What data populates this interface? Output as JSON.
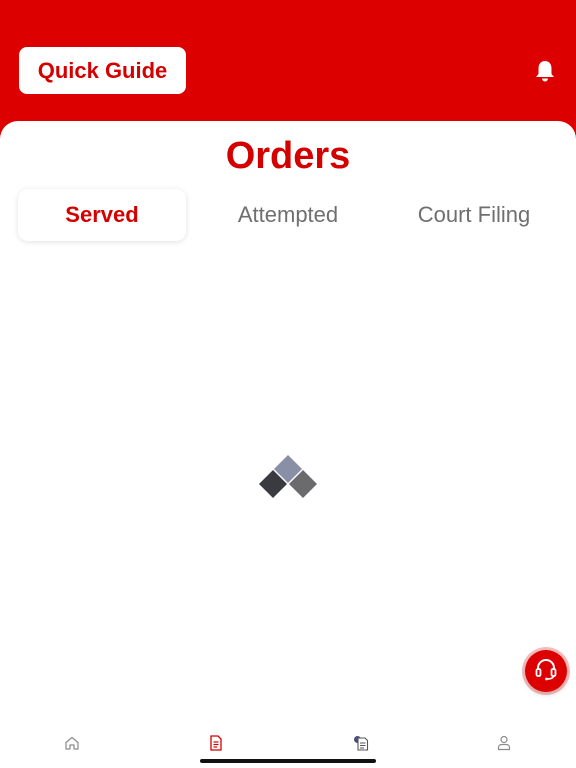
{
  "header": {
    "quick_guide_label": "Quick Guide",
    "bell_icon": "bell-icon",
    "background_color": "#dd0000"
  },
  "main": {
    "title": "Orders",
    "tabs": [
      {
        "label": "Served",
        "active": true
      },
      {
        "label": "Attempted",
        "active": false
      },
      {
        "label": "Court Filing",
        "active": false
      }
    ],
    "accent_color": "#d40000",
    "loading": true
  },
  "support_button": {
    "icon": "headset-icon"
  },
  "bottom_nav": {
    "items": [
      {
        "icon": "home-icon",
        "active": false
      },
      {
        "icon": "document-icon",
        "active": true
      },
      {
        "icon": "documents-icon",
        "active": false
      },
      {
        "icon": "user-icon",
        "active": false
      }
    ]
  }
}
